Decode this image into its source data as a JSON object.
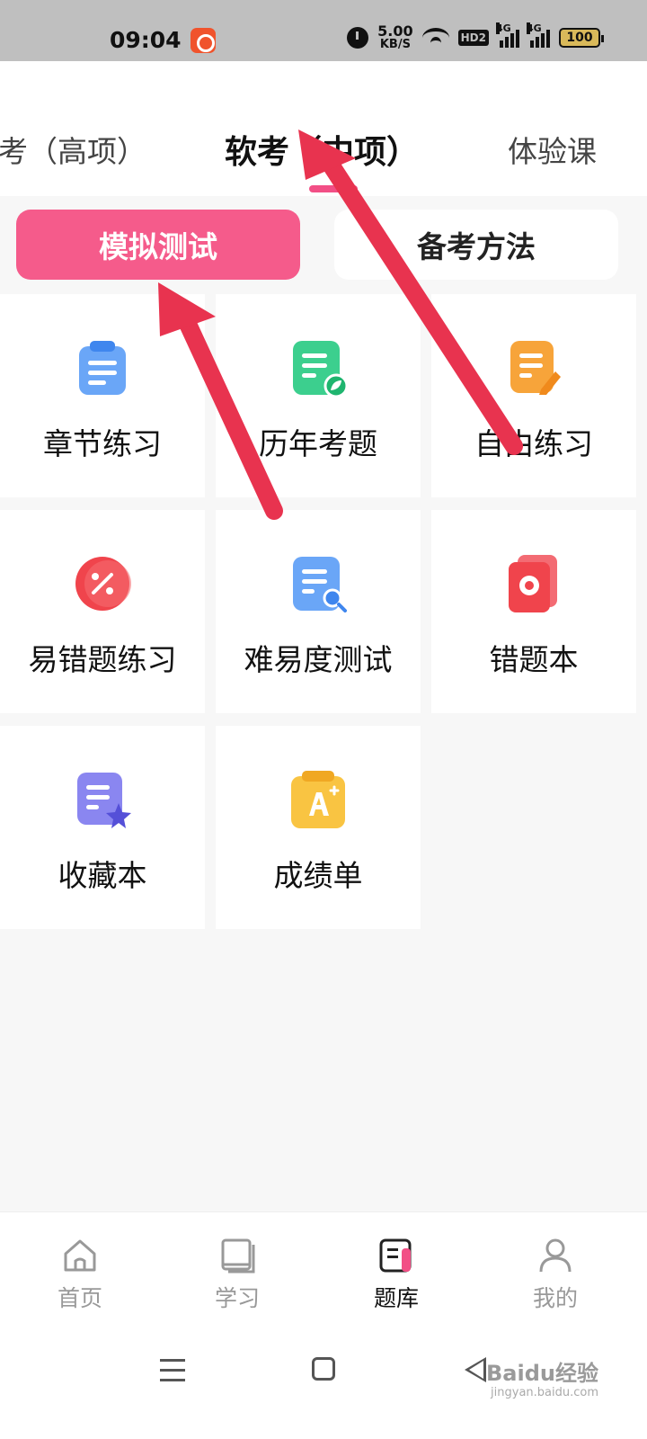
{
  "status_bar": {
    "time": "09:04",
    "speed_value": "5.00",
    "speed_unit": "KB/S",
    "hd_label": "HD2",
    "net1": "4G",
    "net2": "4G",
    "battery": "100"
  },
  "top_tabs": {
    "items": [
      {
        "label": "考（高项）",
        "state": "partial"
      },
      {
        "label": "软考（中项）",
        "state": "active"
      },
      {
        "label": "体验课",
        "state": "normal"
      }
    ],
    "indicator_color": "#f24f86"
  },
  "segments": {
    "active_label": "模拟测试",
    "inactive_label": "备考方法",
    "active_color": "#f55b8b"
  },
  "grid": {
    "items": [
      {
        "label": "章节练习",
        "icon": "clipboard-icon",
        "color": "#5b9cf5"
      },
      {
        "label": "历年考题",
        "icon": "document-leaf-icon",
        "color": "#3ccf8e"
      },
      {
        "label": "自由练习",
        "icon": "notebook-pencil-icon",
        "color": "#f7a43a"
      },
      {
        "label": "易错题练习",
        "icon": "percent-icon",
        "color": "#f0444c"
      },
      {
        "label": "难易度测试",
        "icon": "document-search-icon",
        "color": "#5b9cf5"
      },
      {
        "label": "错题本",
        "icon": "flower-book-icon",
        "color": "#f0444c"
      },
      {
        "label": "收藏本",
        "icon": "document-star-icon",
        "color": "#8a86f0"
      },
      {
        "label": "成绩单",
        "icon": "grade-a-plus-icon",
        "color": "#f9c442"
      }
    ]
  },
  "bottom_nav": {
    "items": [
      {
        "label": "首页",
        "icon": "home-icon",
        "active": false
      },
      {
        "label": "学习",
        "icon": "book-icon",
        "active": false
      },
      {
        "label": "题库",
        "icon": "question-bank-icon",
        "active": true
      },
      {
        "label": "我的",
        "icon": "person-icon",
        "active": false
      }
    ]
  },
  "watermark": {
    "text": "Baidu经验",
    "url": "jingyan.baidu.com"
  },
  "annotation_color": "#e8334f"
}
